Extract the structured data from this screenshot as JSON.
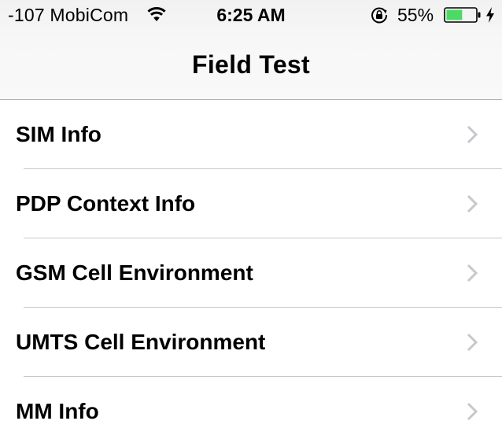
{
  "status_bar": {
    "carrier": "-107 MobiCom",
    "time": "6:25 AM",
    "battery_percent": "55%",
    "battery_level": 0.55,
    "icons": [
      "wifi-icon",
      "rotation-lock-icon",
      "battery-icon",
      "charging-bolt-icon"
    ]
  },
  "nav": {
    "title": "Field Test"
  },
  "list": {
    "items": [
      {
        "label": "SIM Info"
      },
      {
        "label": "PDP Context Info"
      },
      {
        "label": "GSM Cell Environment"
      },
      {
        "label": "UMTS Cell Environment"
      },
      {
        "label": "MM Info"
      }
    ]
  },
  "colors": {
    "battery_fill": "#4cd964",
    "separator": "#c8c7cc",
    "chevron": "#c7c7cc"
  }
}
